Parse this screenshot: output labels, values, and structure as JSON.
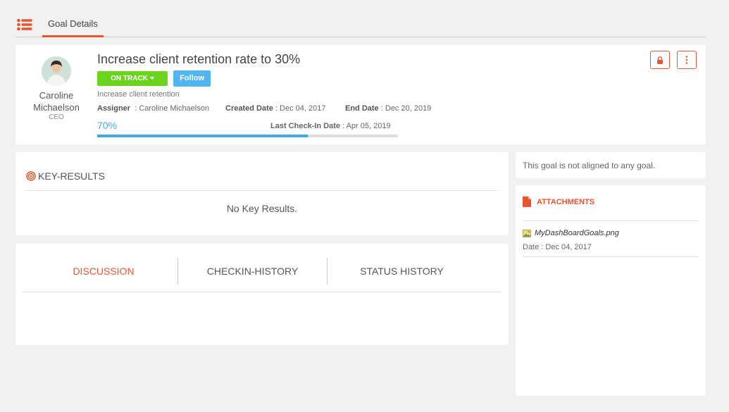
{
  "header": {
    "tab_label": "Goal Details"
  },
  "goal": {
    "owner_name": "Caroline Michaelson",
    "owner_role": "CEO",
    "title": "Increase client retention rate to 30%",
    "status": "ON TRACK",
    "follow_label": "Follow",
    "description": "Increase client retention",
    "assigner_label": "Assigner",
    "assigner_value": ": Caroline Michaelson",
    "created_label": "Created Date",
    "created_value": ": Dec 04, 2017",
    "end_label": "End Date",
    "end_value": ": Dec 20, 2019",
    "progress_label": "70%",
    "progress_fraction": 0.7,
    "last_checkin_label": "Last Check-In Date",
    "last_checkin_value": ": Apr 05, 2019"
  },
  "key_results": {
    "heading": "KEY-RESULTS",
    "empty_text": "No Key Results."
  },
  "tabs": [
    {
      "label": "DISCUSSION",
      "active": true
    },
    {
      "label": "CHECKIN-HISTORY",
      "active": false
    },
    {
      "label": "STATUS HISTORY",
      "active": false
    }
  ],
  "alignment": {
    "text": "This goal is not aligned to any goal."
  },
  "attachments": {
    "heading": "ATTACHMENTS",
    "items": [
      {
        "file_name": "MyDashBoardGoals.png",
        "date": "Date : Dec 04, 2017"
      }
    ]
  },
  "colors": {
    "accent": "#e8542d",
    "status_green": "#6bd31c",
    "follow_blue": "#4fb6f0",
    "progress_blue": "#45a8e6"
  },
  "icons": {
    "menu": "list-icon",
    "lock": "lock-icon",
    "more": "more-vertical-icon",
    "key_results": "target-icon",
    "attachments": "document-icon",
    "file": "image-file-icon"
  }
}
